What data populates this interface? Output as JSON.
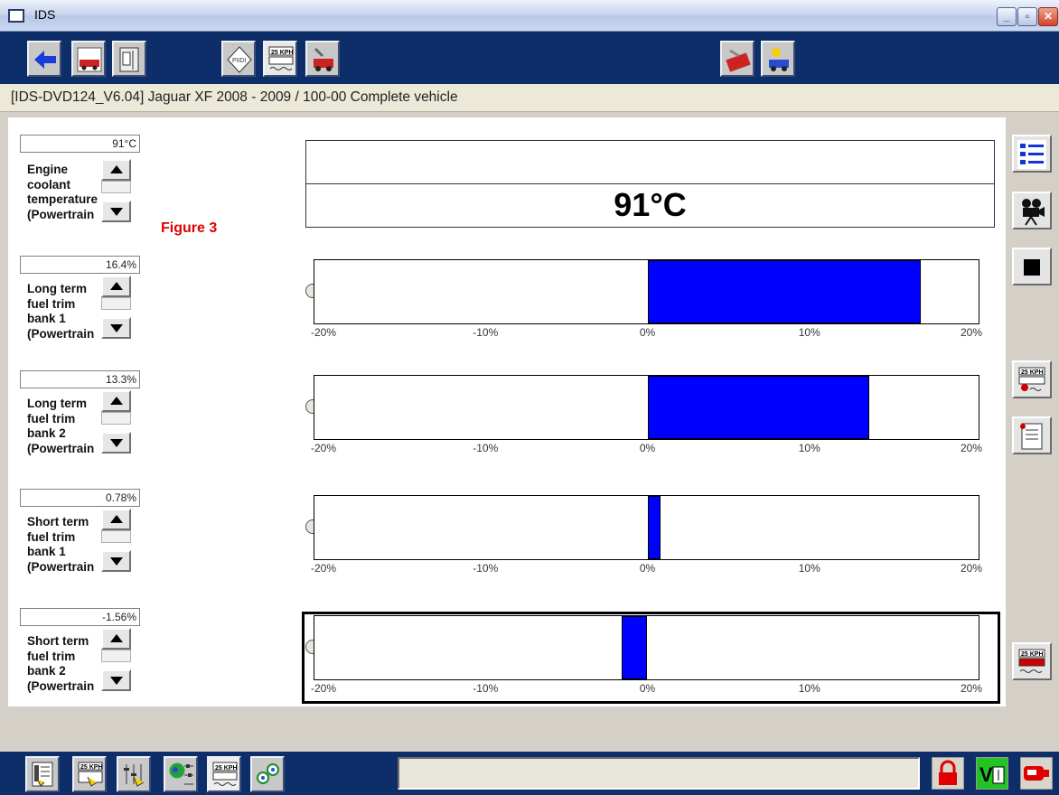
{
  "window": {
    "title": "IDS"
  },
  "breadcrumb": "[IDS-DVD124_V6.04]   Jaguar XF 2008 - 2009 / 100-00 Complete vehicle",
  "toolbar_icons": [
    "back-arrow-icon",
    "vehicle-info-icon",
    "notebook-icon",
    "engine-chip-icon",
    "speedometer-datalogger-icon",
    "service-car-icon",
    "toolbox-icon",
    "car-sun-icon"
  ],
  "annotation": "Figure 3",
  "temperature": {
    "value": "91°C",
    "label": "Engine\ncoolant\ntemperature\n(Powertrain",
    "big": "91°C"
  },
  "gauges": [
    {
      "value_text": "16.4%",
      "value": 16.4,
      "label": "Long term\nfuel trim\nbank 1\n(Powertrain"
    },
    {
      "value_text": "13.3%",
      "value": 13.3,
      "label": "Long term\nfuel trim\nbank 2\n(Powertrain"
    },
    {
      "value_text": "0.78%",
      "value": 0.78,
      "label": "Short term\nfuel trim\nbank 1\n(Powertrain"
    },
    {
      "value_text": "-1.56%",
      "value": -1.56,
      "label": "Short term\nfuel trim\nbank 2\n(Powertrain"
    }
  ],
  "scale_ticks": [
    "-20%",
    "-10%",
    "0%",
    "10%",
    "20%"
  ],
  "scale": {
    "min": -20,
    "max": 20
  },
  "right_icons": [
    "list-icon",
    "camera-icon",
    "stop-icon",
    "recorder-icon",
    "notepad-icon",
    "datalogger-icon"
  ],
  "bottom_icons": [
    "phone-list-icon",
    "speedometer-hand-icon",
    "hand-settings-icon",
    "globe-settings-icon",
    "datalogger-tab-icon",
    "network-icon"
  ],
  "status_icons": [
    "lock-icon",
    "battery-voltage-icon",
    "vci-plug-icon"
  ],
  "colors": {
    "bar": "#0000ff",
    "toolbar_bg": "#0d2e69",
    "annotation": "#e00000"
  }
}
